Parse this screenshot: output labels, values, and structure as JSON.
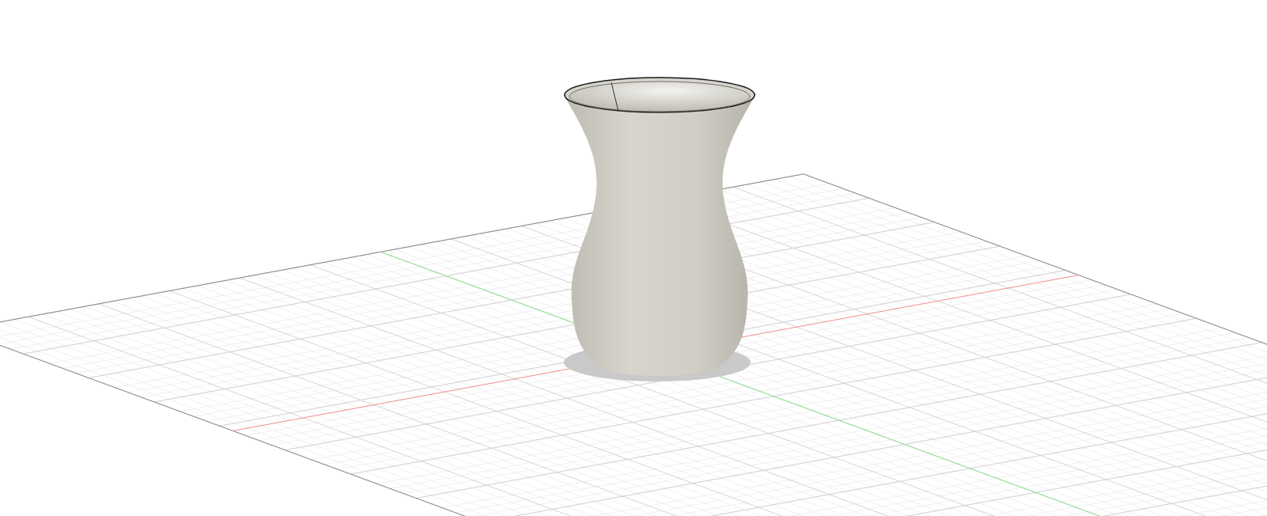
{
  "viewport": {
    "grid": {
      "shown": true
    },
    "axes": {
      "shown": true
    },
    "model": {
      "kind": "vase",
      "shadow": true
    }
  }
}
